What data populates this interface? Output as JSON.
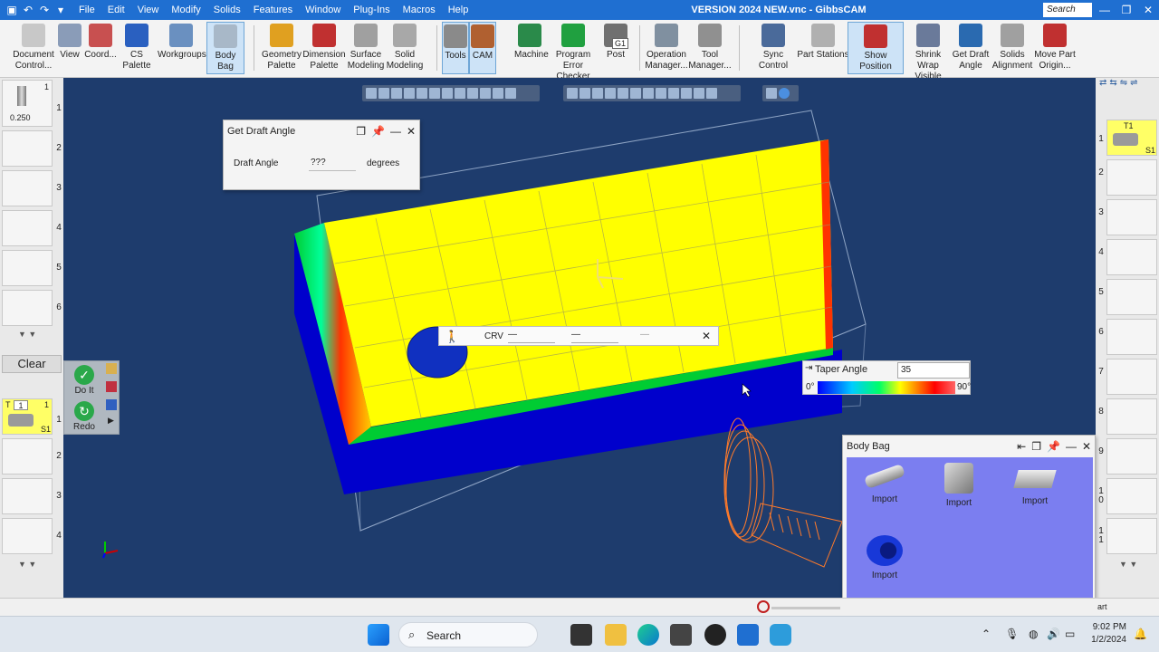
{
  "window": {
    "title": "VERSION 2024 NEW.vnc - GibbsCAM",
    "search_placeholder": "Search",
    "controls": [
      "—",
      "❐",
      "✕"
    ]
  },
  "menu": [
    "File",
    "Edit",
    "View",
    "Modify",
    "Solids",
    "Features",
    "Window",
    "Plug-Ins",
    "Macros",
    "Help"
  ],
  "toolbar": {
    "items": [
      {
        "label": "Document Control...",
        "icon": "document-icon"
      },
      {
        "label": "View",
        "icon": "view-icon"
      },
      {
        "label": "Coord...",
        "icon": "coordinate-icon"
      },
      {
        "label": "CS Palette",
        "icon": "cs-palette-icon"
      },
      {
        "label": "Workgroups",
        "icon": "workgroups-icon"
      },
      {
        "label": "Body Bag",
        "icon": "body-bag-icon"
      },
      {
        "label": "Geometry Palette",
        "icon": "geometry-icon"
      },
      {
        "label": "Dimension Palette",
        "icon": "dimension-icon"
      },
      {
        "label": "Surface Modeling",
        "icon": "surface-icon"
      },
      {
        "label": "Solid Modeling",
        "icon": "solid-icon"
      },
      {
        "label": "Tools",
        "icon": "tools-icon"
      },
      {
        "label": "CAM",
        "icon": "cam-icon"
      },
      {
        "label": "Machine",
        "icon": "machine-icon"
      },
      {
        "label": "Program Error Checker",
        "icon": "check-icon"
      },
      {
        "label": "Post",
        "icon": "post-icon"
      },
      {
        "label": "Operation Manager...",
        "icon": "operation-icon"
      },
      {
        "label": "Tool Manager...",
        "icon": "tool-manager-icon"
      },
      {
        "label": "Sync Control",
        "icon": "sync-icon"
      },
      {
        "label": "Part Stations",
        "icon": "part-stations-icon"
      },
      {
        "label": "Show Position",
        "icon": "crosshair-icon"
      },
      {
        "label": "Shrink Wrap Visible",
        "icon": "shrink-wrap-icon"
      },
      {
        "label": "Get Draft Angle",
        "icon": "draft-angle-icon"
      },
      {
        "label": "Solids Alignment",
        "icon": "alignment-icon"
      },
      {
        "label": "Move Part Origin...",
        "icon": "move-origin-icon"
      }
    ],
    "g1_label": "G1"
  },
  "left_tool_list": {
    "first_tool": {
      "top": "1",
      "mid": "1",
      "size": "0.250"
    },
    "slots": [
      "2",
      "3",
      "4",
      "5",
      "6"
    ]
  },
  "left_lower_list": {
    "clear_label": "Clear",
    "do_it_label": "Do It",
    "redo_label": "Redo",
    "tile": {
      "t_label": "T",
      "t_value": "1",
      "num": "1",
      "station": "S1",
      "row": "1"
    },
    "slots": [
      "2",
      "3",
      "4"
    ]
  },
  "right_list": {
    "tile": {
      "label": "T1",
      "station": "S1",
      "row": "1"
    },
    "slots": [
      "2",
      "3",
      "4",
      "5",
      "6",
      "7",
      "8",
      "9",
      "1\n0",
      "1\n1"
    ]
  },
  "draft_dialog": {
    "title": "Get Draft Angle",
    "field_label": "Draft Angle",
    "field_value": "???",
    "unit": "degrees"
  },
  "crv_bar": {
    "label": "CRV",
    "field1": "—",
    "field2": "—",
    "field3": "—"
  },
  "taper": {
    "label": "Taper Angle",
    "value": "35",
    "min_label": "0°",
    "max_label": "90°"
  },
  "body_bag": {
    "title": "Body Bag",
    "items": [
      "Import",
      "Import",
      "Import",
      "Import"
    ]
  },
  "status": {
    "right_text": "art"
  },
  "taskbar": {
    "search_label": "Search",
    "time": "9:02 PM",
    "date": "1/2/2024"
  },
  "colors": {
    "accent": "#1f6fd1",
    "viewport_bg": "#1e3c6d",
    "part_top": "#ffff00",
    "part_side": "#0000cc",
    "edge_green": "#00cc33",
    "body_bag_bg": "#7b7ef0"
  }
}
